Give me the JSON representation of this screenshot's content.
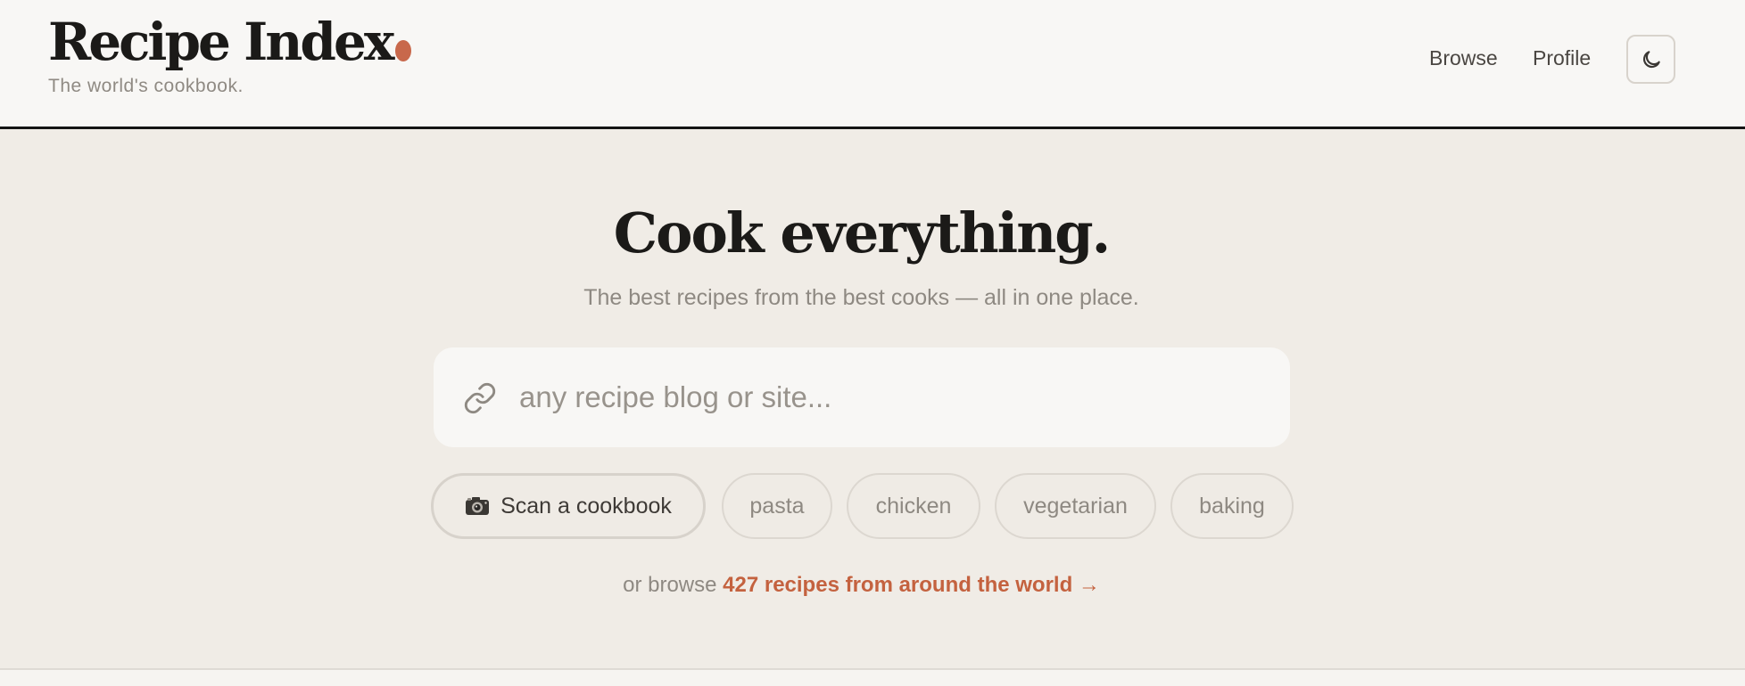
{
  "header": {
    "logo_text": "Recipe Index",
    "tagline": "The world's cookbook.",
    "nav": [
      {
        "label": "Browse"
      },
      {
        "label": "Profile"
      }
    ],
    "theme_toggle_icon": "moon-icon",
    "accent_color": "#c8684b"
  },
  "hero": {
    "title": "Cook everything.",
    "subtitle": "The best recipes from the best cooks — all in one place."
  },
  "search": {
    "icon": "link-icon",
    "placeholder": "any recipe blog or site...",
    "value": ""
  },
  "chips": {
    "scan": {
      "icon": "camera-icon",
      "label": "Scan a cookbook"
    },
    "suggestions": [
      {
        "label": "pasta"
      },
      {
        "label": "chicken"
      },
      {
        "label": "vegetarian"
      },
      {
        "label": "baking"
      }
    ]
  },
  "browse": {
    "prefix": "or browse",
    "link_text": "427 recipes from around the world →",
    "link_color": "#c4623f"
  }
}
